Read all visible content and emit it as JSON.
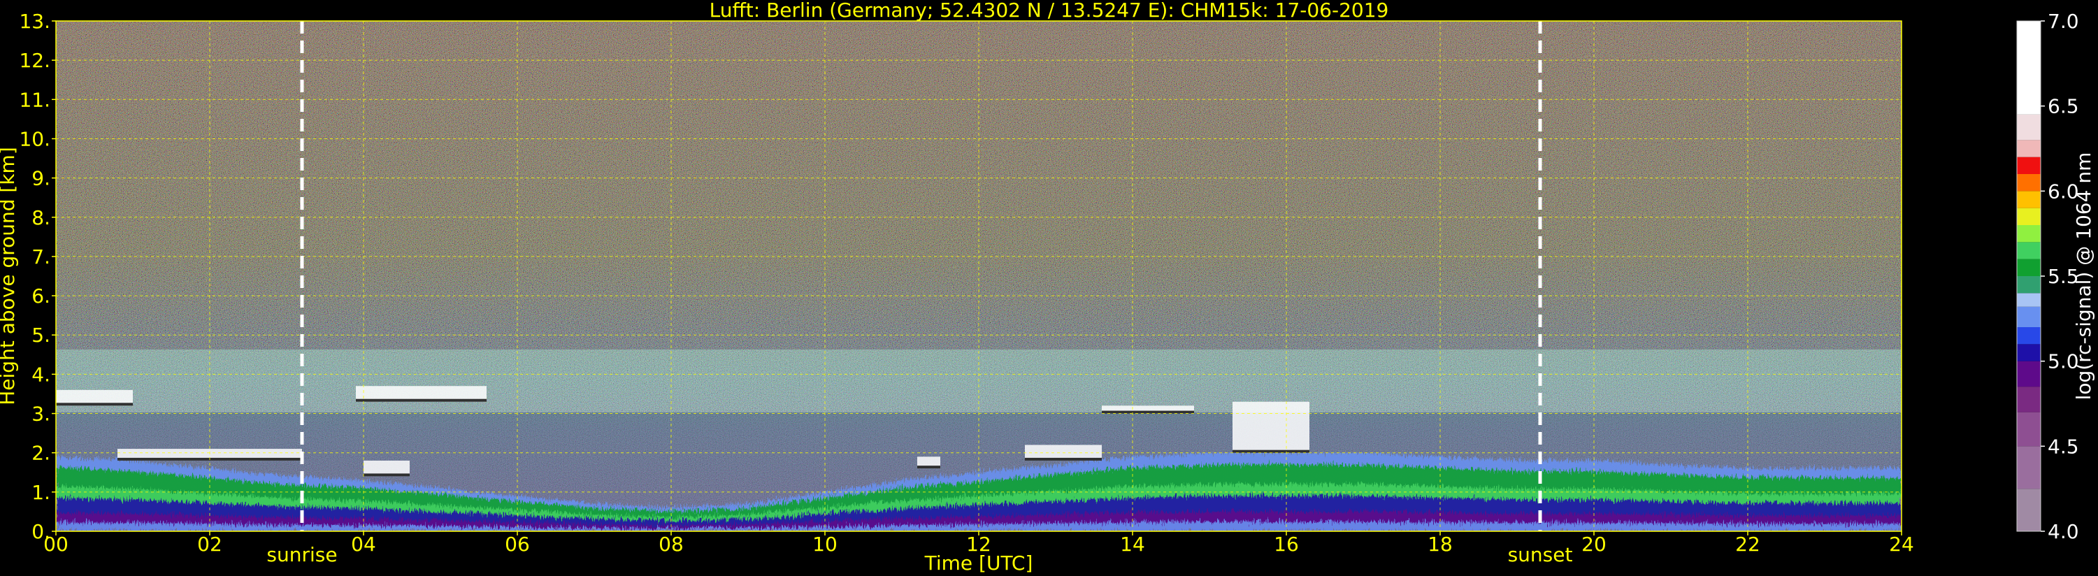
{
  "chart_data": {
    "type": "heatmap",
    "title": "Lufft: Berlin (Germany; 52.4302 N / 13.5247 E):    CHM15k: 17-06-2019",
    "xlabel": "Time [UTC]",
    "ylabel": "Height above ground [km]",
    "x_unit": "hours UTC",
    "y_unit": "km",
    "xlim": [
      0,
      24
    ],
    "ylim": [
      0,
      13
    ],
    "xticks": [
      "00",
      "02",
      "04",
      "06",
      "08",
      "10",
      "12",
      "14",
      "16",
      "18",
      "20",
      "22",
      "24"
    ],
    "yticks": [
      "0.",
      "1.",
      "2.",
      "3.",
      "4.",
      "5.",
      "6.",
      "7.",
      "8.",
      "9.",
      "10.",
      "11.",
      "12.",
      "13."
    ],
    "grid": true,
    "grid_color": "#ffff00",
    "colorbar": {
      "label": "log(rc-signal) @ 1064 nm",
      "range": [
        4.0,
        7.0
      ],
      "ticks": [
        "4.0",
        "4.5",
        "5.0",
        "5.5",
        "6.0",
        "6.5",
        "7.0"
      ],
      "colors": [
        {
          "from": 4.0,
          "to": 4.25,
          "color": "#a08aa4"
        },
        {
          "from": 4.25,
          "to": 4.5,
          "color": "#9a6e9e"
        },
        {
          "from": 4.5,
          "to": 4.7,
          "color": "#8e4f92"
        },
        {
          "from": 4.7,
          "to": 4.85,
          "color": "#7a2a82"
        },
        {
          "from": 4.85,
          "to": 5.0,
          "color": "#5e0a8a"
        },
        {
          "from": 5.0,
          "to": 5.1,
          "color": "#1e10a8"
        },
        {
          "from": 5.1,
          "to": 5.2,
          "color": "#2848e8"
        },
        {
          "from": 5.2,
          "to": 5.32,
          "color": "#6890f0"
        },
        {
          "from": 5.32,
          "to": 5.4,
          "color": "#a8c4f4"
        },
        {
          "from": 5.4,
          "to": 5.5,
          "color": "#30a070"
        },
        {
          "from": 5.5,
          "to": 5.6,
          "color": "#10a030"
        },
        {
          "from": 5.6,
          "to": 5.7,
          "color": "#40d060"
        },
        {
          "from": 5.7,
          "to": 5.8,
          "color": "#90f040"
        },
        {
          "from": 5.8,
          "to": 5.9,
          "color": "#e8f020"
        },
        {
          "from": 5.9,
          "to": 6.0,
          "color": "#ffc000"
        },
        {
          "from": 6.0,
          "to": 6.1,
          "color": "#ff7000"
        },
        {
          "from": 6.1,
          "to": 6.2,
          "color": "#f01010"
        },
        {
          "from": 6.2,
          "to": 6.3,
          "color": "#f0b8b8"
        },
        {
          "from": 6.3,
          "to": 6.45,
          "color": "#f0dde0"
        },
        {
          "from": 6.45,
          "to": 7.0,
          "color": "#ffffff"
        }
      ]
    },
    "markers": [
      {
        "label": "sunrise",
        "time": 3.2,
        "color": "#ffffff"
      },
      {
        "label": "sunset",
        "time": 19.3,
        "color": "#ffffff"
      }
    ],
    "features": {
      "boundary_layer_top_km": [
        [
          0,
          1.9
        ],
        [
          1,
          1.8
        ],
        [
          2,
          1.6
        ],
        [
          3,
          1.4
        ],
        [
          4,
          1.3
        ],
        [
          5,
          1.1
        ],
        [
          6,
          0.9
        ],
        [
          7,
          0.7
        ],
        [
          8,
          0.6
        ],
        [
          9,
          0.7
        ],
        [
          10,
          1.0
        ],
        [
          11,
          1.3
        ],
        [
          12,
          1.5
        ],
        [
          13,
          1.7
        ],
        [
          14,
          1.9
        ],
        [
          15,
          2.0
        ],
        [
          16,
          2.0
        ],
        [
          17,
          2.0
        ],
        [
          18,
          1.9
        ],
        [
          19,
          1.8
        ],
        [
          20,
          1.8
        ],
        [
          21,
          1.7
        ],
        [
          22,
          1.6
        ],
        [
          23,
          1.6
        ],
        [
          24,
          1.6
        ]
      ],
      "cloud_layers": [
        {
          "t0": 0.0,
          "t1": 1.0,
          "h0": 3.2,
          "h1": 3.6
        },
        {
          "t0": 3.9,
          "t1": 5.6,
          "h0": 3.3,
          "h1": 3.7
        },
        {
          "t0": 0.8,
          "t1": 3.2,
          "h0": 1.8,
          "h1": 2.1
        },
        {
          "t0": 4.0,
          "t1": 4.6,
          "h0": 1.4,
          "h1": 1.8
        },
        {
          "t0": 11.2,
          "t1": 11.5,
          "h0": 1.6,
          "h1": 1.9
        },
        {
          "t0": 12.6,
          "t1": 13.6,
          "h0": 1.8,
          "h1": 2.2
        },
        {
          "t0": 13.6,
          "t1": 14.8,
          "h0": 3.0,
          "h1": 3.2
        },
        {
          "t0": 15.3,
          "t1": 16.3,
          "h0": 2.0,
          "h1": 3.3
        }
      ]
    }
  }
}
